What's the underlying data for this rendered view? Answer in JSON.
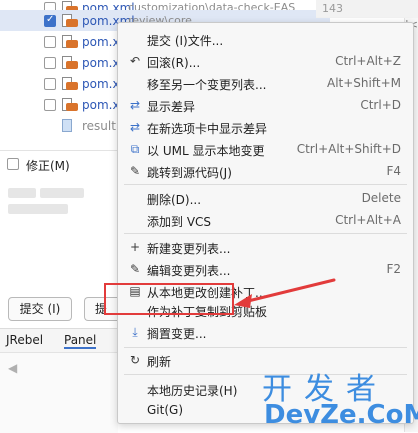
{
  "changes": {
    "files": [
      {
        "name": "pom.xml",
        "path": "customization\\data-check-EAS",
        "checked": false
      },
      {
        "name": "pom.xml",
        "path": "review\\core",
        "checked": true
      },
      {
        "name": "pom.x",
        "path": "",
        "checked": false
      },
      {
        "name": "pom.x",
        "path": "",
        "checked": false
      },
      {
        "name": "pom.x",
        "path": "",
        "checked": false
      },
      {
        "name": "pom.x",
        "path": "",
        "checked": false
      },
      {
        "name": "result",
        "path": "",
        "checked": false
      }
    ],
    "line_number": "143",
    "amend_label": "修正(M)",
    "commit_button": "提交 (I)",
    "commit_push_button": "提",
    "tabs": [
      "JRebel",
      "Panel"
    ],
    "right_edge_label": "|<"
  },
  "context_menu": {
    "items": [
      {
        "label": "提交 (I)文件...",
        "shortcut": "",
        "icon": "none",
        "icon_name": ""
      },
      {
        "label": "回滚(R)...",
        "shortcut": "Ctrl+Alt+Z",
        "icon": "↶",
        "icon_name": "rollback-icon"
      },
      {
        "label": "移至另一个变更列表...",
        "shortcut": "Alt+Shift+M",
        "icon": "",
        "icon_name": ""
      },
      {
        "label": "显示差异",
        "shortcut": "Ctrl+D",
        "icon": "⇄",
        "icon_name": "diff-icon"
      },
      {
        "label": "在新选项卡中显示差异",
        "shortcut": "",
        "icon": "⇄",
        "icon_name": "diff-new-tab-icon"
      },
      {
        "label": "以 UML 显示本地变更",
        "shortcut": "Ctrl+Alt+Shift+D",
        "icon": "⧉",
        "icon_name": "uml-icon"
      },
      {
        "label": "跳转到源代码(J)",
        "shortcut": "F4",
        "icon": "✎",
        "icon_name": "jump-source-icon"
      },
      {
        "label": "删除(D)...",
        "shortcut": "Delete",
        "icon": "",
        "icon_name": ""
      },
      {
        "label": "添加到 VCS",
        "shortcut": "Ctrl+Alt+A",
        "icon": "",
        "icon_name": ""
      },
      {
        "label": "新建变更列表...",
        "shortcut": "",
        "icon": "+",
        "icon_name": "plus-icon"
      },
      {
        "label": "编辑变更列表...",
        "shortcut": "F2",
        "icon": "✎",
        "icon_name": "edit-icon"
      },
      {
        "label": "从本地更改创建补丁...",
        "shortcut": "",
        "icon": "▤",
        "icon_name": "patch-icon"
      },
      {
        "label": "作为补丁复制到剪贴板",
        "shortcut": "",
        "icon": "",
        "icon_name": ""
      },
      {
        "label": "搁置变更...",
        "shortcut": "",
        "icon": "⤓",
        "icon_name": "shelve-icon"
      },
      {
        "label": "刷新",
        "shortcut": "",
        "icon": "↻",
        "icon_name": "refresh-icon"
      },
      {
        "label": "本地历史记录(H)",
        "shortcut": "",
        "icon": "",
        "icon_name": ""
      },
      {
        "label": "Git(G)",
        "shortcut": "",
        "icon": "",
        "icon_name": ""
      }
    ]
  },
  "watermark": {
    "zh": "开发者",
    "en": "DevZe.CoM",
    "small": ".com"
  },
  "colors": {
    "accent": "#3d72c9",
    "highlight_red": "#e23b3b",
    "watermark_blue": "#3d8de0"
  }
}
